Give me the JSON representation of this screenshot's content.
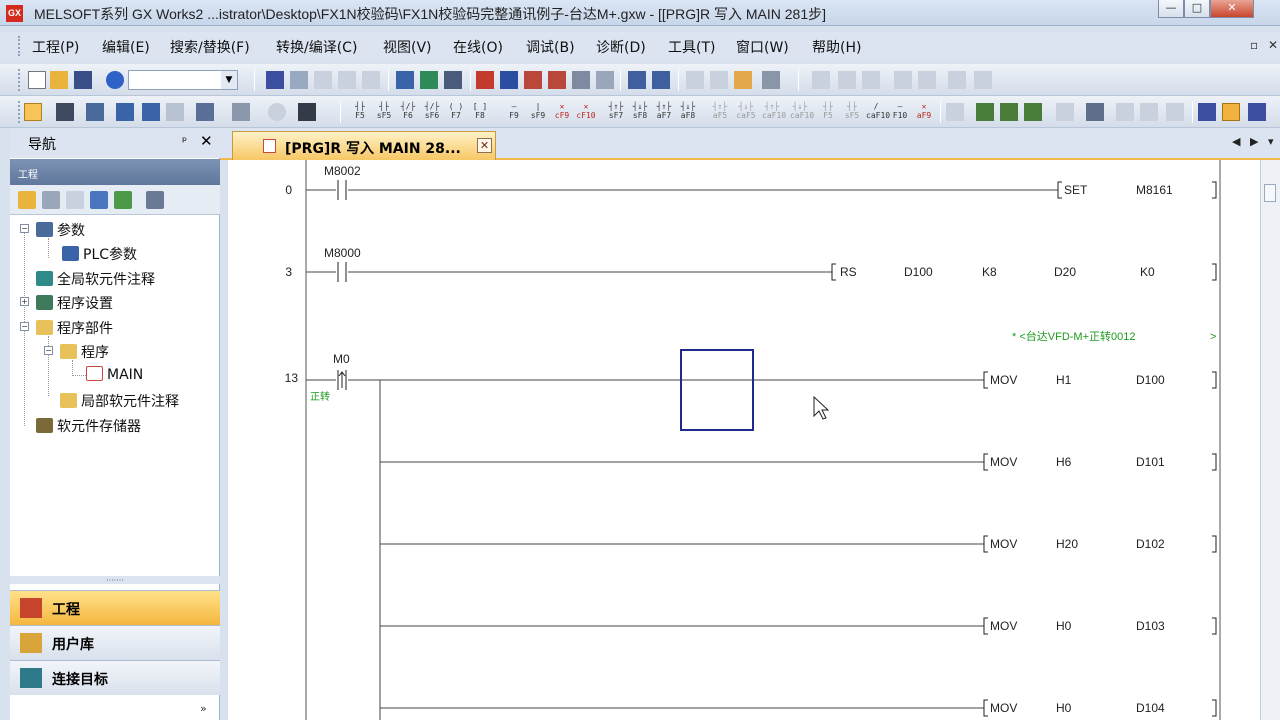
{
  "window": {
    "app_icon_text": "GX",
    "title": "MELSOFT系列 GX Works2 ...istrator\\Desktop\\FX1N校验码\\FX1N校验码完整通讯例子-台达M+.gxw - [[PRG]R 写入 MAIN 281步]",
    "minimize": "—",
    "maximize": "□",
    "close": "✕"
  },
  "menu": {
    "items": [
      "工程(P)",
      "编辑(E)",
      "搜索/替换(F)",
      "转换/编译(C)",
      "视图(V)",
      "在线(O)",
      "调试(B)",
      "诊断(D)",
      "工具(T)",
      "窗口(W)",
      "帮助(H)"
    ],
    "mdi_restore": "▫",
    "mdi_close": "✕"
  },
  "toolbar": {
    "combo_value": "",
    "ladder_keys": [
      "F5",
      "sF5",
      "F6",
      "sF6",
      "F7",
      "F8",
      "F9",
      "sF9",
      "cF9",
      "cF10",
      "sF7",
      "sF8",
      "aF7",
      "aF8",
      "aF5",
      "caF5",
      "caF10",
      "F10",
      "aF9"
    ]
  },
  "nav": {
    "title": "导航",
    "pin": "ᵖ",
    "close": "✕",
    "section": "工程",
    "tree": [
      {
        "label": "参数"
      },
      {
        "label": "PLC参数"
      },
      {
        "label": "全局软元件注释"
      },
      {
        "label": "程序设置"
      },
      {
        "label": "程序部件"
      },
      {
        "label": "程序"
      },
      {
        "label": "MAIN"
      },
      {
        "label": "局部软元件注释"
      },
      {
        "label": "软元件存储器"
      }
    ],
    "splitter": "·······",
    "tabs": [
      "工程",
      "用户库",
      "连接目标"
    ],
    "more": "»"
  },
  "editor": {
    "tab_label": "[PRG]R 写入 MAIN 28...",
    "tab_close": "✕",
    "nav_left": "◀",
    "nav_right": "▶",
    "nav_menu": "▾",
    "rungs": [
      {
        "step": "0",
        "contact": "M8002",
        "instruction": "SET",
        "operands": [
          "M8161"
        ]
      },
      {
        "step": "3",
        "contact": "M8000",
        "instruction": "RS",
        "operands": [
          "D100",
          "K8",
          "D20",
          "K0"
        ]
      },
      {
        "step": "13",
        "contact": "M0",
        "contact_comment": "正转",
        "statement": "* <台达VFD-M+正转0012",
        "statement_end": ">",
        "outputs": [
          {
            "instruction": "MOV",
            "operands": [
              "H1",
              "D100"
            ]
          },
          {
            "instruction": "MOV",
            "operands": [
              "H6",
              "D101"
            ]
          },
          {
            "instruction": "MOV",
            "operands": [
              "H20",
              "D102"
            ]
          },
          {
            "instruction": "MOV",
            "operands": [
              "H0",
              "D103"
            ]
          },
          {
            "instruction": "MOV",
            "operands": [
              "H0",
              "D104"
            ]
          }
        ]
      }
    ]
  },
  "colors": {
    "accent": "#f5b73e",
    "comment_green": "#1e9a1e",
    "cursor_blue": "#1f2b8c",
    "title_gradient_top": "#dbe6f4"
  }
}
